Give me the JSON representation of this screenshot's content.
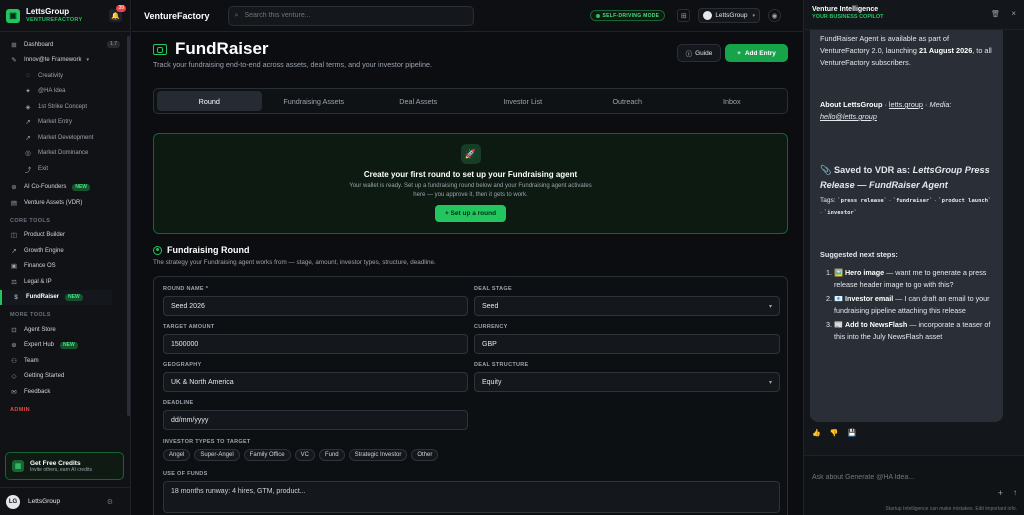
{
  "brand": {
    "name": "LettsGroup",
    "sub": "VENTUREFACTORY",
    "logo": "LG",
    "bell_count": "39"
  },
  "sidebar": {
    "items": [
      {
        "label": "Dashboard",
        "icon": "⊞",
        "badge": "1.7"
      },
      {
        "label": "Innov@te Framework",
        "icon": "✎",
        "chevron": "▾"
      }
    ],
    "subitems": [
      {
        "label": "Creativity",
        "icon": "◌"
      },
      {
        "label": "@HA Idea",
        "icon": "✦"
      },
      {
        "label": "1st Strike Concept",
        "icon": "◈"
      },
      {
        "label": "Market Entry",
        "icon": "↗"
      },
      {
        "label": "Market Development",
        "icon": "↗"
      },
      {
        "label": "Market Dominance",
        "icon": "◎"
      },
      {
        "label": "Exit",
        "icon": "⤴"
      }
    ],
    "items2": [
      {
        "label": "AI Co-Founders",
        "icon": "⊛",
        "badge": "NEW"
      },
      {
        "label": "Venture Assets (VDR)",
        "icon": "▤"
      }
    ],
    "core_title": "CORE TOOLS",
    "core": [
      {
        "label": "Product Builder",
        "icon": "◫"
      },
      {
        "label": "Growth Engine",
        "icon": "↗"
      },
      {
        "label": "Finance OS",
        "icon": "▣"
      },
      {
        "label": "Legal & IP",
        "icon": "⚖"
      },
      {
        "label": "FundRaiser",
        "icon": "$",
        "badge": "NEW"
      }
    ],
    "more_title": "MORE TOOLS",
    "more": [
      {
        "label": "Agent Store",
        "icon": "⊡"
      },
      {
        "label": "Expert Hub",
        "icon": "⊕",
        "badge": "NEW"
      },
      {
        "label": "Team",
        "icon": "⚇"
      },
      {
        "label": "Getting Started",
        "icon": "◇"
      },
      {
        "label": "Feedback",
        "icon": "✉"
      }
    ],
    "admin_title": "ADMIN",
    "credits": {
      "title": "Get Free Credits",
      "sub": "Invite others, earn AI credits",
      "icon": "▦"
    },
    "user": {
      "name": "LettsGroup",
      "initials": "LG",
      "gear": "⚙"
    }
  },
  "topbar": {
    "title": "VentureFactory",
    "search_placeholder": "Search this venture...",
    "self_driving": "SELF-DRIVING MODE",
    "workspace": "LettsGroup"
  },
  "page": {
    "title": "FundRaiser",
    "subtitle": "Track your fundraising end-to-end across assets, deal terms, and your investor pipeline.",
    "guide": "Guide",
    "add": "Add Entry",
    "tabs": [
      "Round",
      "Fundraising Assets",
      "Deal Assets",
      "Investor List",
      "Outreach",
      "Inbox"
    ],
    "setup": {
      "title": "Create your first round to set up your Fundraising agent",
      "desc": "Your wallet is ready. Set up a fundraising round below and your Fundraising agent activates here — you approve it, then it gets to work.",
      "button": "Set up a round"
    },
    "section_title": "Fundraising Round",
    "section_desc": "The strategy your Fundraising agent works from — stage, amount, investor types, structure, deadline."
  },
  "form": {
    "round_name_label": "ROUND NAME *",
    "round_name": "Seed 2026",
    "deal_stage_label": "DEAL STAGE",
    "deal_stage": "Seed",
    "target_label": "TARGET AMOUNT",
    "target": "1500000",
    "currency_label": "CURRENCY",
    "currency": "GBP",
    "geo_label": "GEOGRAPHY",
    "geo": "UK & North America",
    "structure_label": "DEAL STRUCTURE",
    "structure": "Equity",
    "deadline_label": "DEADLINE",
    "deadline": "dd/mm/yyyy",
    "investor_label": "INVESTOR TYPES TO TARGET",
    "investor_types": [
      "Angel",
      "Super-Angel",
      "Family Office",
      "VC",
      "Fund",
      "Strategic Investor",
      "Other"
    ],
    "funds_label": "USE OF FUNDS",
    "funds": "18 months runway: 4 hires, GTM, product..."
  },
  "rpanel": {
    "title": "Venture Intelligence",
    "sub": "YOUR BUSINESS COPILOT",
    "p1a": "FundRaiser Agent is available as part of VentureFactory 2.0, launching ",
    "p1b": "21 August 2026",
    "p1c": ", to all VentureFactory subscribers.",
    "about_label": "About LettsGroup",
    "about_link": "letts.group",
    "media_label": "Media:",
    "media_email": "hello@letts.group",
    "saved_prefix": "📎 Saved to VDR as:",
    "saved_name": "LettsGroup Press Release — FundRaiser Agent",
    "tags_label": "Tags:",
    "tags": [
      "`press release`",
      "`fundraiser`",
      "`product launch`",
      "`investor`"
    ],
    "steps_title": "Suggested next steps:",
    "steps": [
      {
        "icon": "🖼️",
        "bold": "Hero image",
        "text": " — want me to generate a press release header image to go with this?"
      },
      {
        "icon": "📧",
        "bold": "Investor email",
        "text": " — I can draft an email to your fundraising pipeline attaching this release"
      },
      {
        "icon": "📰",
        "bold": "Add to NewsFlash",
        "text": " — incorporate a teaser of this into the July NewsFlash asset"
      }
    ],
    "input_placeholder": "Ask about Generate @HA Idea...",
    "disclaimer": "Startup Intelligence can make mistakes. Edit important info."
  }
}
